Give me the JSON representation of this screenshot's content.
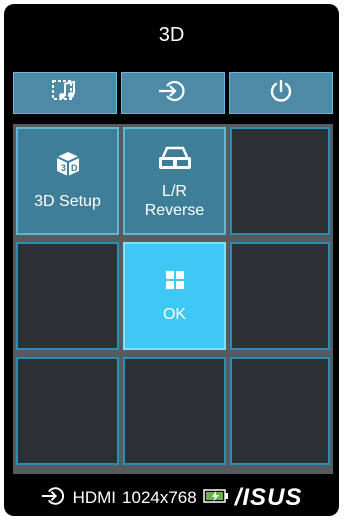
{
  "header": {
    "title": "3D"
  },
  "toolbar": {
    "buttons": [
      {
        "icon": "music-image-icon"
      },
      {
        "icon": "input-source-icon"
      },
      {
        "icon": "power-icon"
      }
    ]
  },
  "tiles": [
    {
      "label": "3D Setup",
      "icon": "3d-cube-icon",
      "state": "filled"
    },
    {
      "label": "L/R\nReverse",
      "icon": "3d-glasses-icon",
      "state": "filled"
    },
    {
      "label": "",
      "state": "empty"
    },
    {
      "label": "",
      "state": "empty"
    },
    {
      "label": "OK",
      "icon": "grid-icon",
      "state": "selected"
    },
    {
      "label": "",
      "state": "empty"
    },
    {
      "label": "",
      "state": "empty"
    },
    {
      "label": "",
      "state": "empty"
    },
    {
      "label": "",
      "state": "empty"
    }
  ],
  "status": {
    "input": "HDMI",
    "resolution": "1024x768",
    "brand": "/ISUS"
  },
  "colors": {
    "background": "#000000",
    "tile_filled": "#3f7e99",
    "tile_selected": "#3ec8f5",
    "tile_border": "#2a8eb3"
  }
}
